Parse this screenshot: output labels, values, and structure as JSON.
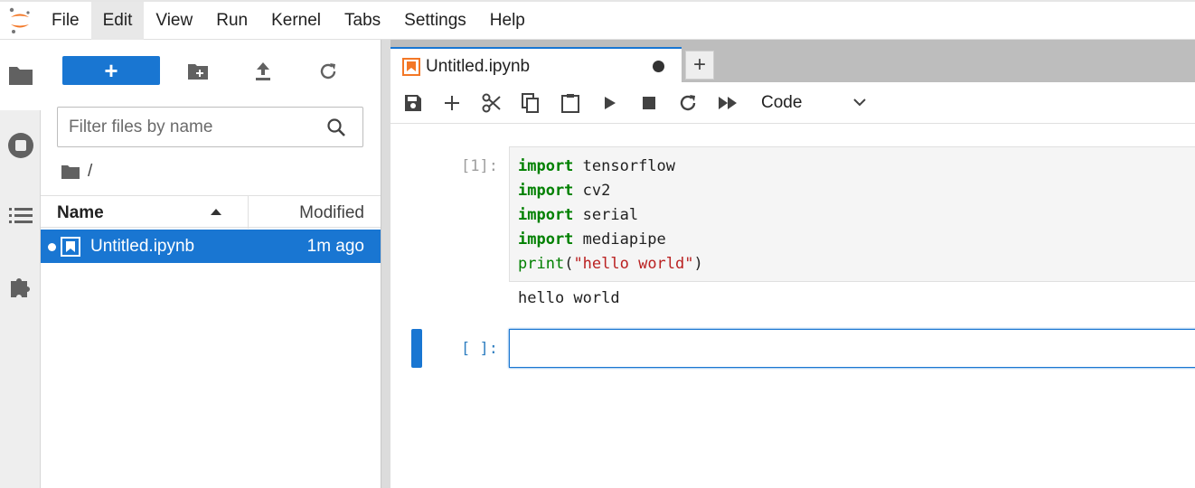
{
  "menu": {
    "items": [
      "File",
      "Edit",
      "View",
      "Run",
      "Kernel",
      "Tabs",
      "Settings",
      "Help"
    ],
    "active": "Edit"
  },
  "activity": {
    "icons": [
      "folder-icon",
      "stop-circle-icon",
      "list-icon",
      "puzzle-icon"
    ]
  },
  "filebrowser": {
    "new_label": "+",
    "filter_placeholder": "Filter files by name",
    "path": "/",
    "col_name": "Name",
    "col_modified": "Modified",
    "files": [
      {
        "name": "Untitled.ipynb",
        "modified": "1m ago"
      }
    ]
  },
  "notebook": {
    "tab_label": "Untitled.ipynb",
    "add_tab_label": "+",
    "cell_type": "Code",
    "cells": [
      {
        "prompt": "[1]:",
        "lines": [
          {
            "kw": "import",
            "rest": " tensorflow"
          },
          {
            "kw": "import",
            "rest": " cv2"
          },
          {
            "kw": "import",
            "rest": " serial"
          },
          {
            "kw": "import",
            "rest": " mediapipe"
          }
        ],
        "print_fn": "print",
        "print_open": "(",
        "print_str": "\"hello world\"",
        "print_close": ")",
        "output": "hello world"
      },
      {
        "prompt": "[ ]:"
      }
    ]
  },
  "colors": {
    "accent": "#1976d2",
    "logo": "#f37726",
    "keyword": "#008000",
    "string": "#ba2121"
  }
}
